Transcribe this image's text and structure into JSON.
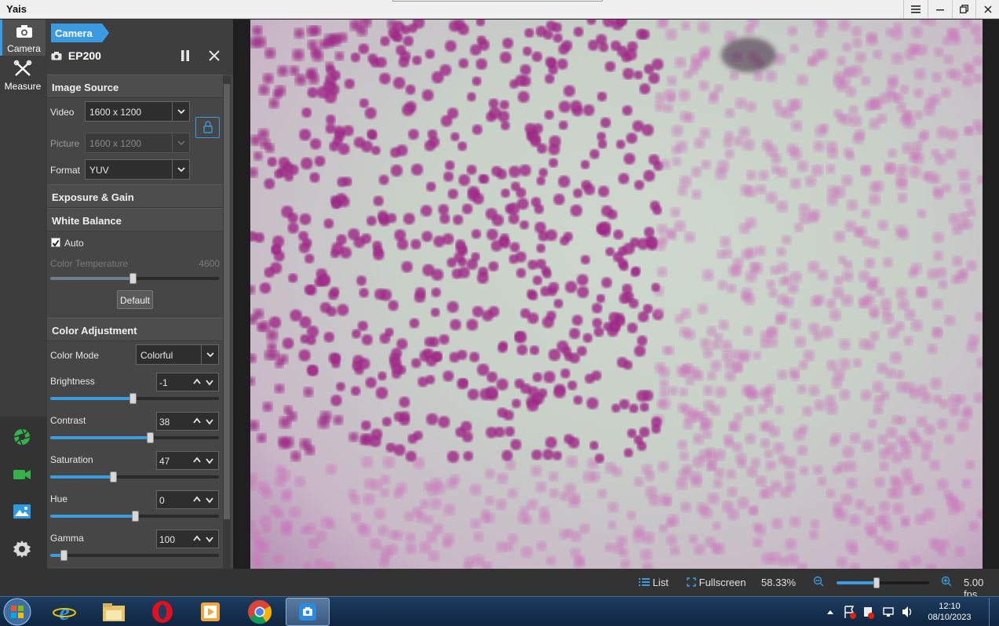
{
  "titlebar": {
    "app_title": "Yais"
  },
  "rail": {
    "tabs": [
      {
        "label": "Camera",
        "icon": "camera-icon"
      },
      {
        "label": "Measure",
        "icon": "measure-icon"
      }
    ],
    "bottom_icons": [
      "aperture-icon",
      "video-icon",
      "image-icon",
      "settings-icon"
    ]
  },
  "panel": {
    "breadcrumb": "Camera",
    "device_name": "EP200",
    "image_source": {
      "title": "Image Source",
      "video_label": "Video",
      "video_value": "1600 x 1200",
      "picture_label": "Picture",
      "picture_value": "1600 x 1200",
      "format_label": "Format",
      "format_value": "YUV"
    },
    "exposure": {
      "title": "Exposure & Gain"
    },
    "white_balance": {
      "title": "White Balance",
      "auto_label": "Auto",
      "auto_checked": true,
      "color_temp_label": "Color Temperature",
      "color_temp_value": "4600",
      "color_temp_fraction": 0.49,
      "default_button": "Default"
    },
    "color_adjustment": {
      "title": "Color Adjustment",
      "color_mode_label": "Color Mode",
      "color_mode_value": "Colorful",
      "controls": [
        {
          "label": "Brightness",
          "value": "-1",
          "fraction": 0.49
        },
        {
          "label": "Contrast",
          "value": "38",
          "fraction": 0.59
        },
        {
          "label": "Saturation",
          "value": "47",
          "fraction": 0.37
        },
        {
          "label": "Hue",
          "value": "0",
          "fraction": 0.5
        },
        {
          "label": "Gamma",
          "value": "100",
          "fraction": 0.08
        }
      ]
    }
  },
  "statusbar": {
    "list_label": "List",
    "fullscreen_label": "Fullscreen",
    "zoom_text": "58.33%",
    "zoom_fraction": 0.43,
    "fps_text": "5.00 fps"
  },
  "taskbar": {
    "apps": [
      "internet-explorer-icon",
      "file-explorer-icon",
      "opera-icon",
      "media-player-icon",
      "chrome-icon",
      "camera-app-icon"
    ],
    "time": "12:10",
    "date": "08/10/2023"
  },
  "colors": {
    "accent": "#3a9be0",
    "panel": "#464646",
    "rail": "#3c3c3c"
  }
}
